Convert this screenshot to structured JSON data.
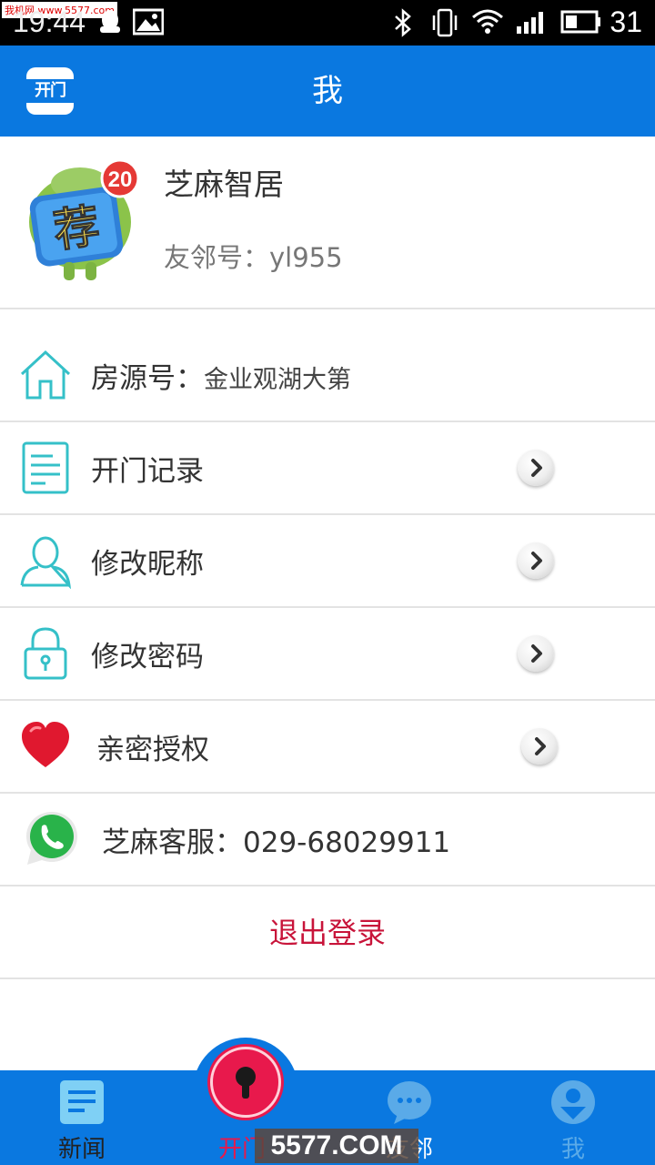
{
  "status_bar": {
    "watermark": "我机网 www.5577.com",
    "time": "19:44",
    "battery": "31"
  },
  "header": {
    "logo_text": "开门",
    "title": "我"
  },
  "profile": {
    "badge_count": "20",
    "avatar_glyph": "荐",
    "name": "芝麻智居",
    "id_label": "友邻号：",
    "id_value": "yl955"
  },
  "rows": [
    {
      "label": "房源号：",
      "value": "金业观湖大第",
      "icon": "house-icon",
      "has_arrow": false
    },
    {
      "label": "开门记录",
      "icon": "document-icon",
      "has_arrow": true
    },
    {
      "label": "修改昵称",
      "icon": "user-icon",
      "has_arrow": true
    },
    {
      "label": "修改密码",
      "icon": "lock-icon",
      "has_arrow": true
    },
    {
      "label": "亲密授权",
      "icon": "heart-icon",
      "has_arrow": true
    },
    {
      "label": "芝麻客服：",
      "value": "029-68029911",
      "icon": "whatsapp-phone-icon",
      "has_arrow": false
    }
  ],
  "logout_label": "退出登录",
  "bottom_nav": {
    "items": [
      {
        "label": "新闻",
        "icon": "news-icon"
      },
      {
        "label": "开门",
        "icon": "key-icon"
      },
      {
        "label": "友邻",
        "icon": "chat-icon"
      },
      {
        "label": "我",
        "icon": "profile-icon"
      }
    ],
    "watermark": "5577.COM"
  },
  "colors": {
    "primary": "#0a78e0",
    "accent_red": "#c8143a",
    "icon_teal": "#35c0c8",
    "nav_active": "#e8194c"
  }
}
